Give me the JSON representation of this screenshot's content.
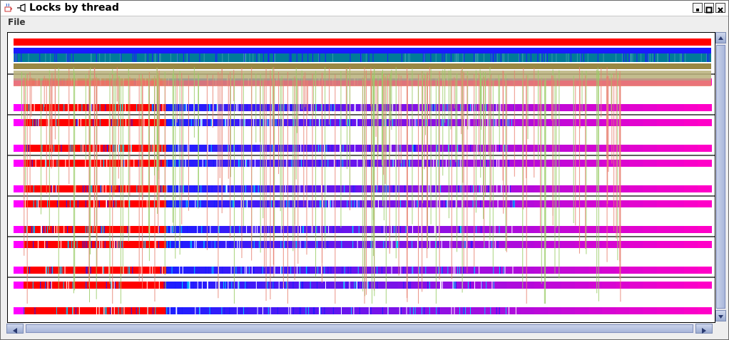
{
  "window": {
    "title": "Locks by thread"
  },
  "menubar": {
    "items": [
      {
        "label": "File"
      }
    ]
  },
  "icons": {
    "app": "java-cup-icon",
    "pin": "pin-icon",
    "minimize": "minimize-icon",
    "maximize": "maximize-icon",
    "close": "close-icon"
  },
  "colors": {
    "lock_red": "#ff0000",
    "lock_blue": "#1a1aff",
    "lock_magenta": "#ff00ff",
    "lock_pink": "#ff1a8c",
    "lock_cyan": "#00ccff",
    "lock_teal": "#007a99",
    "lock_olive": "#998844",
    "contention_green": "#99cc66",
    "contention_salmon": "#e88070"
  }
}
